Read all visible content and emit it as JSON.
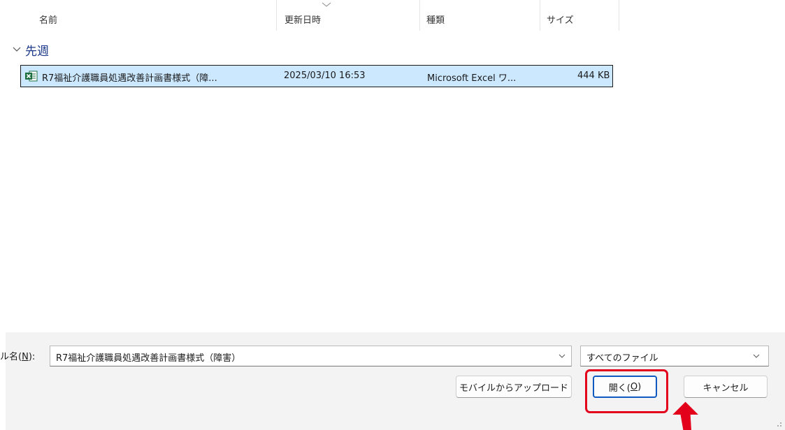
{
  "columns": {
    "name": "名前",
    "modified": "更新日時",
    "type": "種類",
    "size": "サイズ"
  },
  "group": {
    "label": "先週"
  },
  "file": {
    "name": "R7福祉介護職員処遇改善計画書様式（障...",
    "modified": "2025/03/10 16:53",
    "type": "Microsoft Excel ワ...",
    "size": "444 KB",
    "icon": "excel-icon"
  },
  "filename_field": {
    "label_prefix": "ル名(",
    "label_key": "N",
    "label_suffix": "):",
    "value": "R7福祉介護職員処遇改善計画書様式（障害）"
  },
  "filetype_select": {
    "value": "すべてのファイル"
  },
  "buttons": {
    "upload": "モバイルからアップロード",
    "open_prefix": "開く(",
    "open_key": "O",
    "open_suffix": ")",
    "cancel": "キャンセル"
  },
  "annotation": {
    "highlight_color": "#e3001b"
  },
  "colors": {
    "selection_bg": "#cce8ff",
    "accent": "#0f5ac0",
    "excel_green": "#1d6f42"
  }
}
